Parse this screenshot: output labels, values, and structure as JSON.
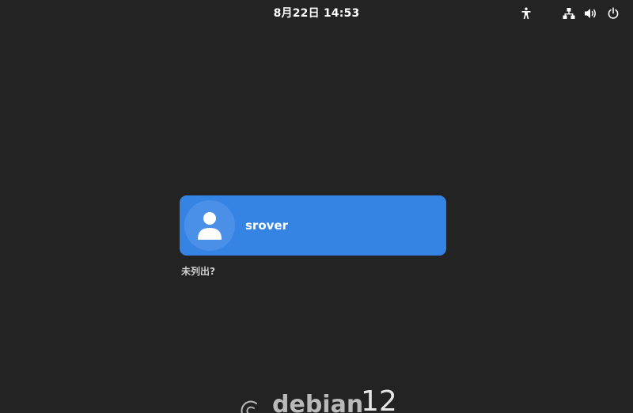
{
  "top_bar": {
    "datetime": "8月22日  14:53",
    "icons": [
      "accessibility-icon",
      "network-wired-icon",
      "volume-icon",
      "power-icon"
    ]
  },
  "login": {
    "user_name": "srover",
    "not_listed_label": "未列出?"
  },
  "branding": {
    "name": "debian",
    "version": "12"
  },
  "colors": {
    "background": "#232323",
    "accent": "#3584e4",
    "text": "#ffffff"
  }
}
